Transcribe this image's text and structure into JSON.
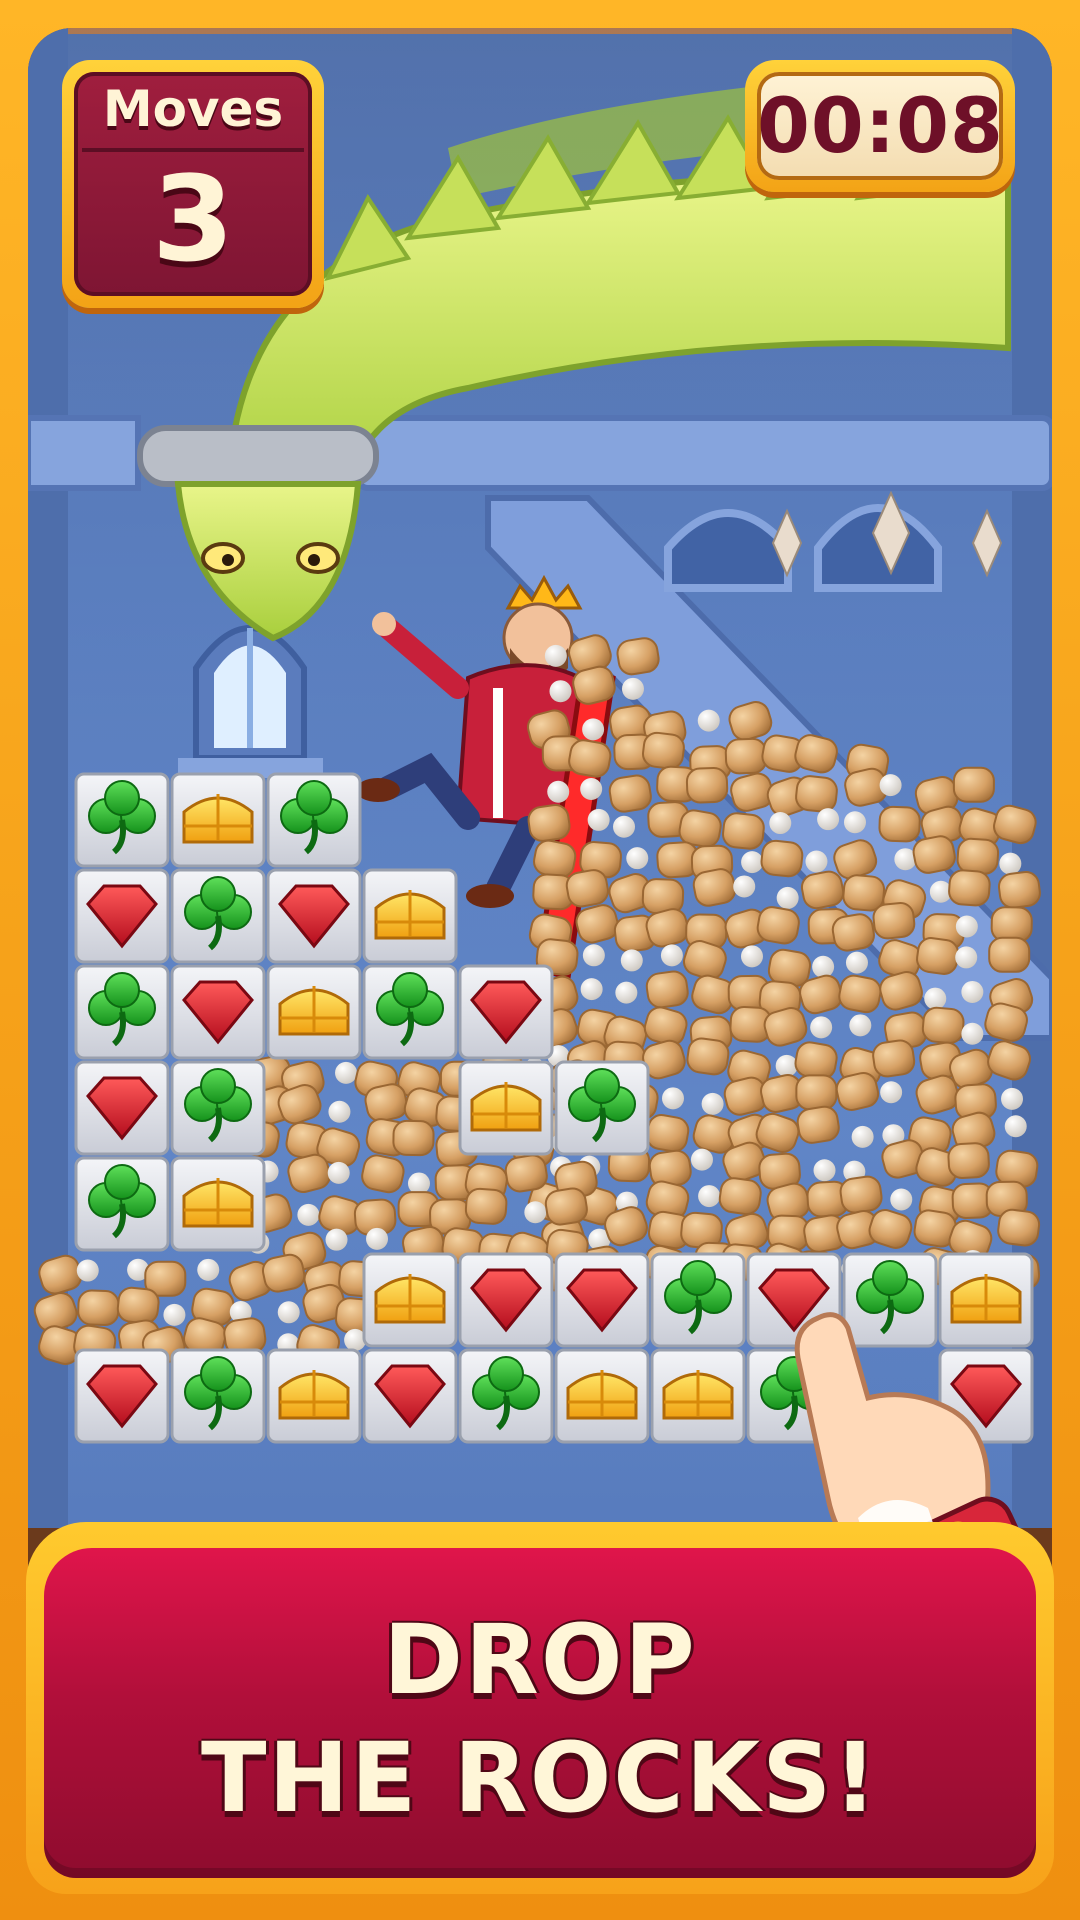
{
  "hud": {
    "moves_label": "Moves",
    "moves_value": "3",
    "timer_value": "00:08"
  },
  "banner": {
    "line1": "DROP",
    "line2": "THE ROCKS!"
  },
  "board": {
    "rows": [
      [
        "clover",
        "crown",
        "clover",
        null,
        null,
        null,
        null,
        null,
        null,
        null
      ],
      [
        "ruby",
        "clover",
        "ruby",
        "crown",
        null,
        null,
        null,
        null,
        null,
        null
      ],
      [
        "clover",
        "ruby",
        "crown",
        "clover",
        "ruby",
        null,
        null,
        null,
        null,
        null
      ],
      [
        "ruby",
        "clover",
        null,
        null,
        "crown",
        "clover",
        null,
        null,
        null,
        null
      ],
      [
        "clover",
        "crown",
        null,
        null,
        null,
        null,
        null,
        null,
        null,
        null
      ],
      [
        null,
        null,
        null,
        "crown",
        "ruby",
        "ruby",
        "clover",
        "ruby",
        "clover",
        "crown"
      ],
      [
        "ruby",
        "clover",
        "crown",
        "ruby",
        "clover",
        "crown",
        "crown",
        "clover",
        null,
        "ruby"
      ]
    ]
  },
  "colors": {
    "ruby": "#e0192b",
    "clover": "#2fb82f",
    "crown": "#ffc21a",
    "tile": "#e6e8ee",
    "rock": "#d9a56b",
    "banner": "#c01240",
    "frame": "#f7a21a"
  },
  "icons": [
    "ruby-gem-icon",
    "clover-gem-icon",
    "crown-gem-icon",
    "pointing-hand-icon"
  ]
}
